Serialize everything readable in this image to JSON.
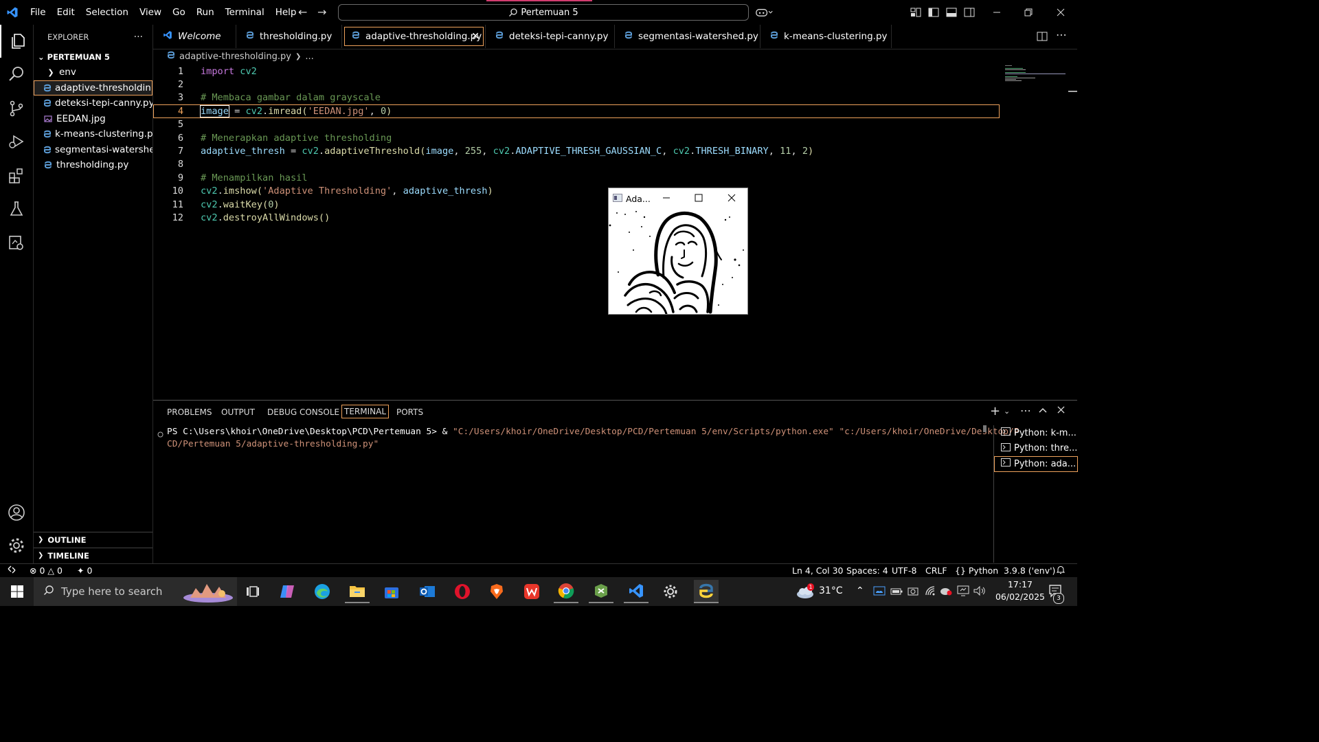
{
  "window_title": "Pertemuan 5",
  "menu": [
    "File",
    "Edit",
    "Selection",
    "View",
    "Go",
    "Run",
    "Terminal",
    "Help"
  ],
  "explorer": {
    "header": "EXPLORER",
    "more": "···",
    "folder": "PERTEMUAN 5",
    "items": [
      {
        "label": "env",
        "type": "folder"
      },
      {
        "label": "adaptive-thresholdin...",
        "type": "py"
      },
      {
        "label": "deteksi-tepi-canny.py",
        "type": "py"
      },
      {
        "label": "EEDAN.jpg",
        "type": "img"
      },
      {
        "label": "k-means-clustering.py",
        "type": "py"
      },
      {
        "label": "segmentasi-watershe...",
        "type": "py"
      },
      {
        "label": "thresholding.py",
        "type": "py"
      }
    ],
    "outline": "OUTLINE",
    "timeline": "TIMELINE"
  },
  "tabs": [
    {
      "label": "Welcome"
    },
    {
      "label": "thresholding.py"
    },
    {
      "label": "adaptive-thresholding.py"
    },
    {
      "label": "deteksi-tepi-canny.py"
    },
    {
      "label": "segmentasi-watershed.py"
    },
    {
      "label": "k-means-clustering.py"
    }
  ],
  "breadcrumb": {
    "file": "adaptive-thresholding.py",
    "rest": "..."
  },
  "code_line_numbers": [
    "1",
    "2",
    "3",
    "4",
    "5",
    "6",
    "7",
    "8",
    "9",
    "10",
    "11",
    "12"
  ],
  "code": {
    "l1_kw": "import",
    "l1_mod": "cv2",
    "l3": "# Membaca gambar dalam grayscale",
    "l4_var": "image",
    "l4_eq": " = ",
    "l4_mod": "cv2",
    "l4_dot": ".",
    "l4_fn": "imread",
    "l4_p1": "(",
    "l4_str": "'EEDAN.jpg'",
    "l4_c": ", ",
    "l4_num": "0",
    "l4_p2": ")",
    "l6": "# Menerapkan adaptive thresholding",
    "l7_var": "adaptive_thresh",
    "l7_eq": " = ",
    "l7_mod": "cv2",
    "l7_dot": ".",
    "l7_fn": "adaptiveThreshold",
    "l7_p1": "(",
    "l7_a1": "image",
    "l7_c1": ", ",
    "l7_n1": "255",
    "l7_c2": ", ",
    "l7_m2": "cv2",
    "l7_d2": ".",
    "l7_a3": "ADAPTIVE_THRESH_GAUSSIAN_C",
    "l7_c3": ", ",
    "l7_m3": "cv2",
    "l7_d3": ".",
    "l7_a4": "THRESH_BINARY",
    "l7_c4": ", ",
    "l7_n2": "11",
    "l7_c5": ", ",
    "l7_n3": "2",
    "l7_p2": ")",
    "l9": "# Menampilkan hasil",
    "l10_mod": "cv2",
    "l10_dot": ".",
    "l10_fn": "imshow",
    "l10_p1": "(",
    "l10_str": "'Adaptive Thresholding'",
    "l10_c": ", ",
    "l10_var": "adaptive_thresh",
    "l10_p2": ")",
    "l11_mod": "cv2",
    "l11_dot": ".",
    "l11_fn": "waitKey",
    "l11_p1": "(",
    "l11_num": "0",
    "l11_p2": ")",
    "l12_mod": "cv2",
    "l12_dot": ".",
    "l12_fn": "destroyAllWindows",
    "l12_p": "()"
  },
  "cv_window": {
    "title": "Ada..."
  },
  "panel": {
    "tabs": [
      "PROBLEMS",
      "OUTPUT",
      "DEBUG CONSOLE",
      "TERMINAL",
      "PORTS"
    ],
    "prompt": "PS C:\\Users\\khoir\\OneDrive\\Desktop\\PCD\\Pertemuan 5> & ",
    "exe": "\"C:/Users/khoir/OneDrive/Desktop/PCD/Pertemuan 5/env/Scripts/python.exe\"",
    "arg1": " \"c:/Users/khoir/OneDrive/Desktop/P",
    "arg2": "CD/Pertemuan 5/adaptive-thresholding.py\"",
    "terminals": [
      "Python: k-m...",
      "Python: thre...",
      "Python: ada..."
    ]
  },
  "status": {
    "errors": "0",
    "warnings": "0",
    "ports": "0",
    "position": "Ln 4, Col 30",
    "spaces": "Spaces: 4",
    "encoding": "UTF-8",
    "eol": "CRLF",
    "language": "Python",
    "interpreter": "3.9.8 ('env')"
  },
  "taskbar": {
    "search_placeholder": "Type here to search",
    "temperature": "31°C",
    "weather_badge": "1",
    "time": "17:17",
    "date": "06/02/2025",
    "notif_count": "3"
  },
  "colors": {
    "accent": "#f0a35c",
    "vscode_blue": "#3794ff",
    "python_blue": "#5b9bd5"
  }
}
